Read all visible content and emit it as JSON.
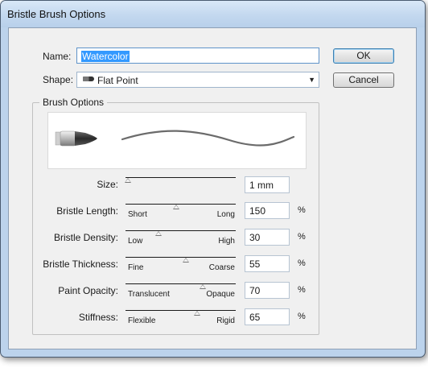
{
  "window": {
    "title": "Bristle Brush Options"
  },
  "name_field": {
    "label": "Name:",
    "value": "Watercolor"
  },
  "shape_field": {
    "label": "Shape:",
    "value": "Flat Point",
    "icon": "flat-point-brush-icon"
  },
  "buttons": {
    "ok": "OK",
    "cancel": "Cancel"
  },
  "brush_options": {
    "title": "Brush Options",
    "rows": [
      {
        "label": "Size:",
        "value": "1 mm",
        "min_label": "",
        "max_label": "",
        "unit": "",
        "slider_fraction": 0.02
      },
      {
        "label": "Bristle Length:",
        "value": "150",
        "min_label": "Short",
        "max_label": "Long",
        "unit": "%",
        "slider_fraction": 0.46
      },
      {
        "label": "Bristle Density:",
        "value": "30",
        "min_label": "Low",
        "max_label": "High",
        "unit": "%",
        "slider_fraction": 0.3
      },
      {
        "label": "Bristle Thickness:",
        "value": "55",
        "min_label": "Fine",
        "max_label": "Coarse",
        "unit": "%",
        "slider_fraction": 0.55
      },
      {
        "label": "Paint Opacity:",
        "value": "70",
        "min_label": "Translucent",
        "max_label": "Opaque",
        "unit": "%",
        "slider_fraction": 0.7
      },
      {
        "label": "Stiffness:",
        "value": "65",
        "min_label": "Flexible",
        "max_label": "Rigid",
        "unit": "%",
        "slider_fraction": 0.65
      }
    ]
  }
}
